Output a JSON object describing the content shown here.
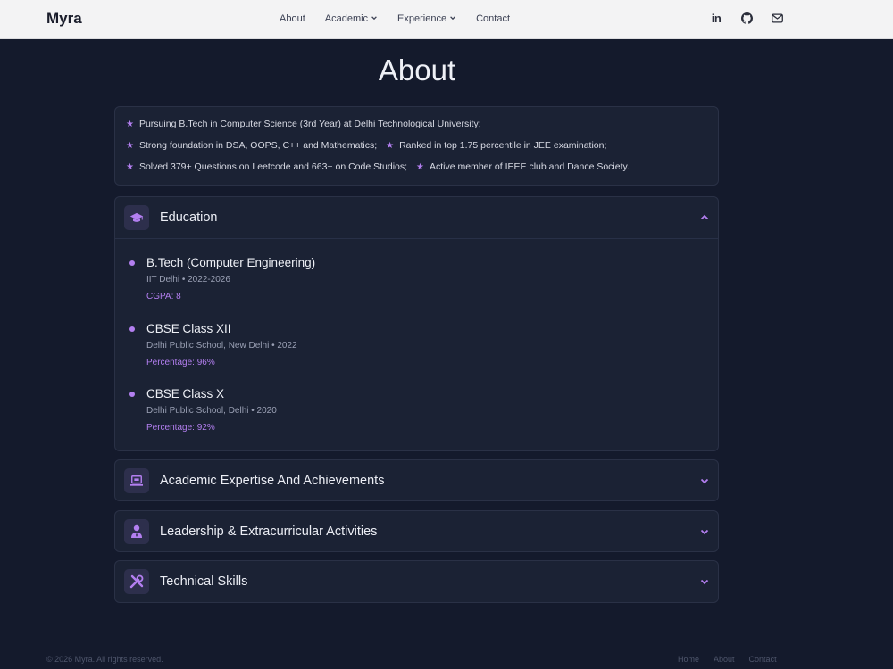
{
  "header": {
    "brand": "Myra",
    "nav": [
      {
        "label": "About",
        "dropdown": false
      },
      {
        "label": "Academic",
        "dropdown": true
      },
      {
        "label": "Experience",
        "dropdown": true
      },
      {
        "label": "Contact",
        "dropdown": false
      }
    ],
    "social": {
      "linkedin": "in",
      "github": "github-icon",
      "mail": "mail-icon"
    }
  },
  "page": {
    "title": "About"
  },
  "highlights": [
    "Pursuing B.Tech in Computer Science (3rd Year) at Delhi Technological University;",
    "Strong foundation in DSA, OOPS, C++ and Mathematics;",
    "Ranked in top 1.75 percentile in JEE examination;",
    "Solved 379+ Questions on Leetcode and 663+ on Code Studios;",
    "Active member of IEEE club and Dance Society."
  ],
  "sections": {
    "education": {
      "title": "Education",
      "expanded": true,
      "items": [
        {
          "degree": "B.Tech (Computer Engineering)",
          "meta": "IIT Delhi • 2022-2026",
          "score": "CGPA: 8"
        },
        {
          "degree": "CBSE Class XII",
          "meta": "Delhi Public School, New Delhi • 2022",
          "score": "Percentage: 96%"
        },
        {
          "degree": "CBSE Class X",
          "meta": "Delhi Public School, Delhi • 2020",
          "score": "Percentage: 92%"
        }
      ]
    },
    "academic": {
      "title": "Academic Expertise And Achievements",
      "expanded": false
    },
    "leadership": {
      "title": "Leadership & Extracurricular Activities",
      "expanded": false
    },
    "technical": {
      "title": "Technical Skills",
      "expanded": false
    }
  },
  "footer": {
    "copyright": "© 2026 Myra. All rights reserved.",
    "links": [
      "Home",
      "About",
      "Contact"
    ]
  },
  "colors": {
    "accent": "#b37ff0",
    "background": "#141a2c",
    "card": "#1b2234",
    "header": "#f3f3f4"
  }
}
